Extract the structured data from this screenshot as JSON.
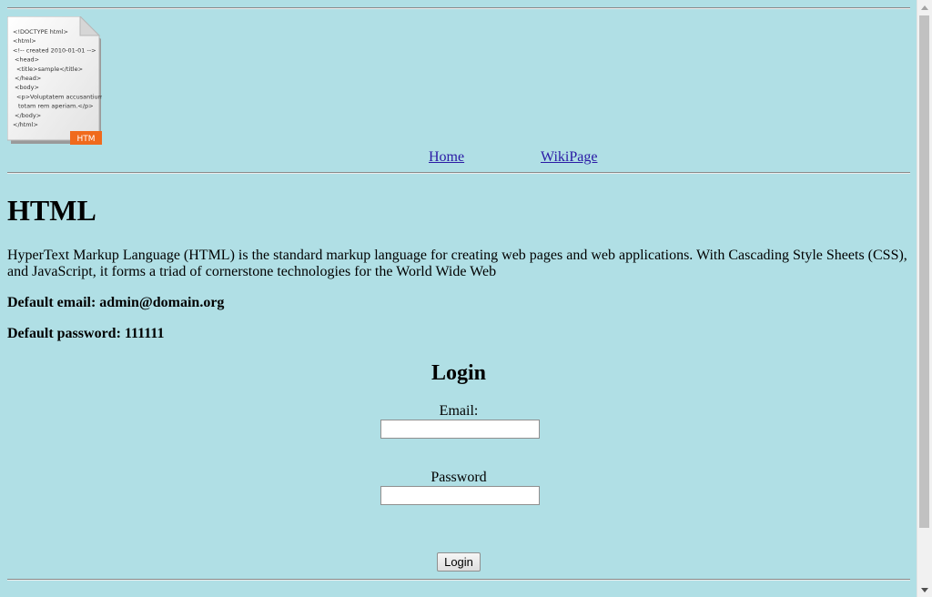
{
  "logo": {
    "icon": "html-document-icon",
    "lines": [
      "<!DOCTYPE html>",
      "<html>",
      "<!-- created 2010-01-01 -->",
      "<head>",
      "<title>sample</title>",
      "</head>",
      "<body>",
      "<p>Voluptatem accusantium",
      "totam rem aperiam.</p>",
      "</body>",
      "</html>"
    ],
    "badge": "HTM",
    "badge_color": "#f06a1c"
  },
  "nav": {
    "home": "Home",
    "wiki": "WikiPage",
    "link_color": "#2a1aa5"
  },
  "page": {
    "title": "HTML",
    "description": "HyperText Markup Language (HTML) is the standard markup language for creating web pages and web applications. With Cascading Style Sheets (CSS), and JavaScript, it forms a triad of cornerstone technologies for the World Wide Web",
    "default_email": "Default email: admin@domain.org",
    "default_password": "Default password: 111111",
    "background": "#b0dfe5"
  },
  "login": {
    "heading": "Login",
    "email_label": "Email:",
    "email_value": "",
    "password_label": "Password",
    "password_value": "",
    "button_label": "Login"
  },
  "scrollbar": {
    "up_icon": "scroll-up-arrow-icon",
    "down_icon": "scroll-down-arrow-icon"
  }
}
